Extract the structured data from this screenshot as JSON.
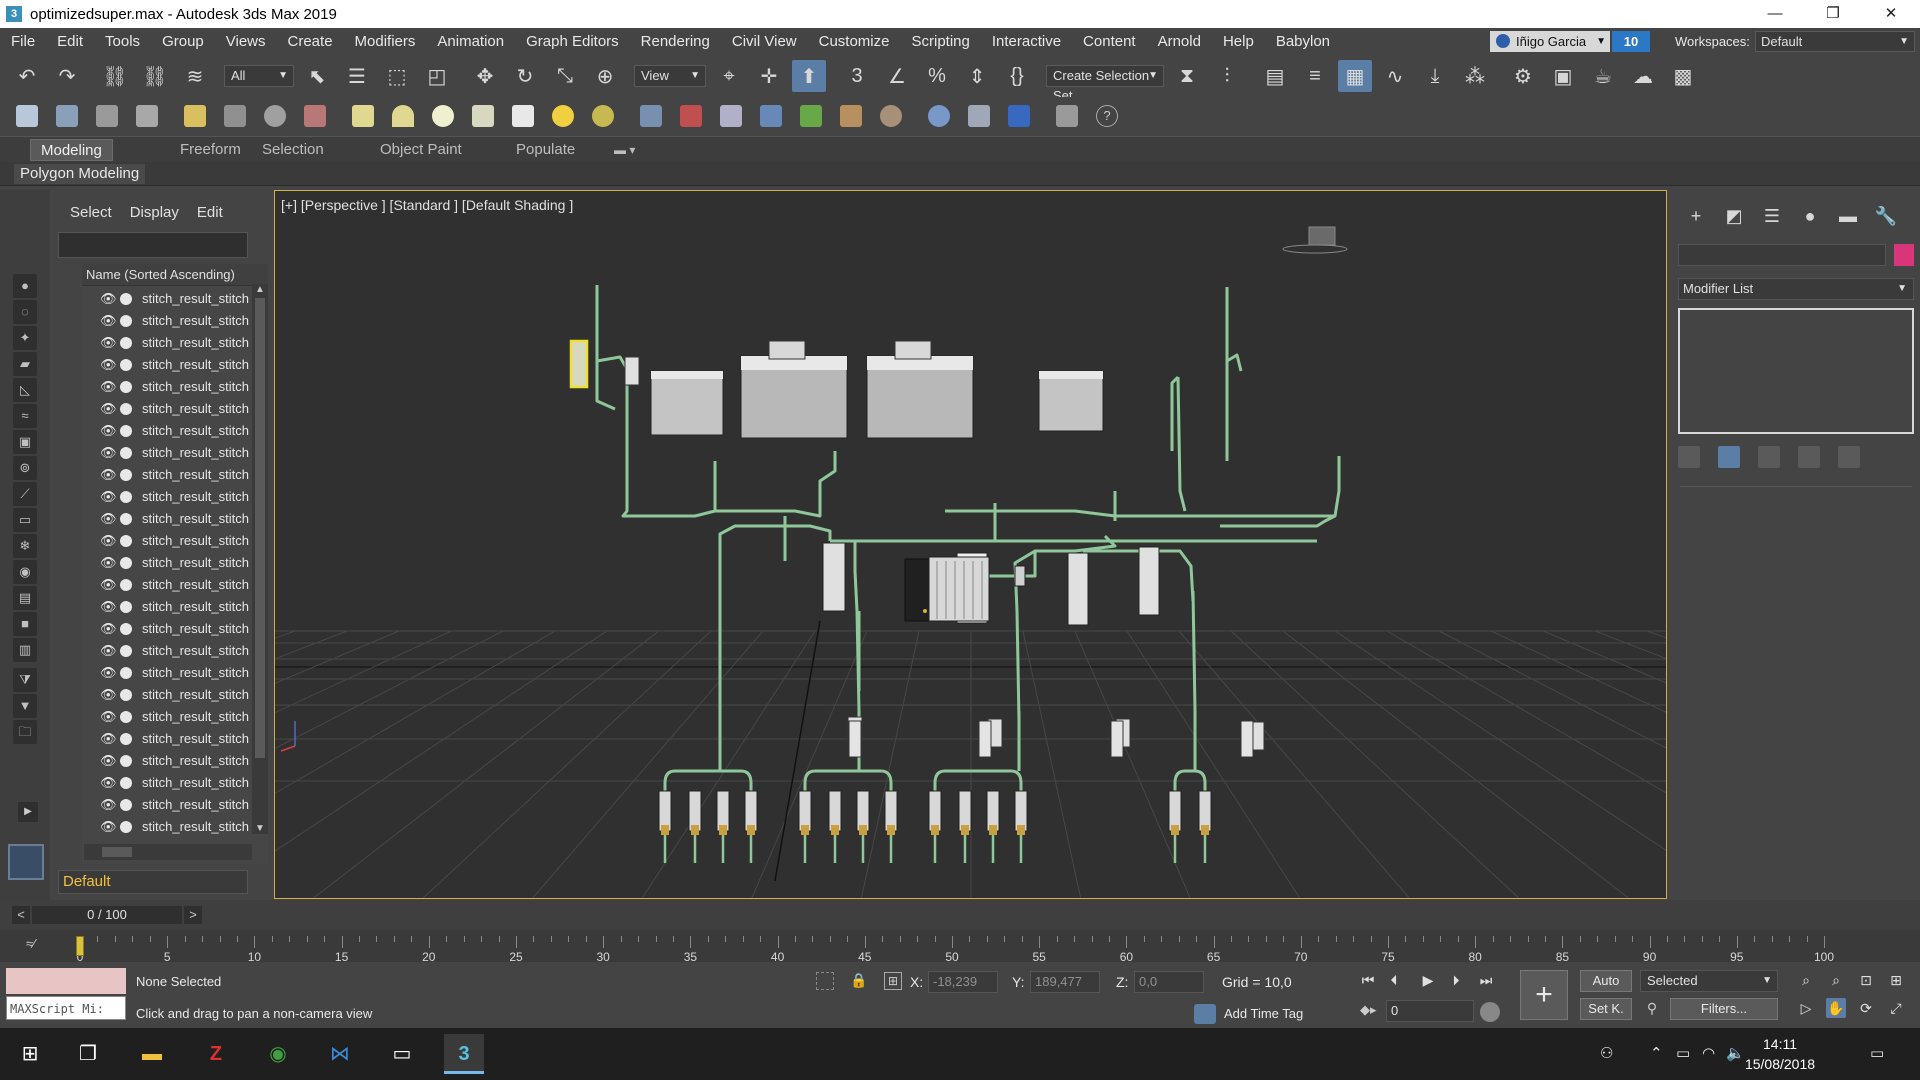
{
  "window": {
    "title": "optimizedsuper.max - Autodesk 3ds Max 2019",
    "app_icon": "3",
    "controls": [
      "—",
      "❐",
      "✕"
    ]
  },
  "menu": {
    "items": [
      "File",
      "Edit",
      "Tools",
      "Group",
      "Views",
      "Create",
      "Modifiers",
      "Animation",
      "Graph Editors",
      "Rendering",
      "Civil View",
      "Customize",
      "Scripting",
      "Interactive",
      "Content",
      "Arnold",
      "Help",
      "Babylon"
    ],
    "user": "Iñigo Garcia",
    "notifications": "10",
    "workspaces_label": "Workspaces:",
    "workspace": "Default"
  },
  "toolbar": {
    "selection_filter": "All",
    "ref_coord": "View",
    "named_selection": "Create Selection Set"
  },
  "ribbon": {
    "tabs": [
      "Modeling",
      "Freeform",
      "Selection",
      "Object Paint",
      "Populate"
    ],
    "active_tab": "Modeling",
    "panel": "Polygon Modeling"
  },
  "explorer": {
    "tabs": [
      "Select",
      "Display",
      "Edit"
    ],
    "column_header": "Name (Sorted Ascending)",
    "row_name": "stitch_result_stitch",
    "row_count": 25,
    "layer": "Default"
  },
  "viewport": {
    "label": "[+] [Perspective ] [Standard ] [Default Shading ]",
    "colors": {
      "background": "#303030",
      "grid": "#474747",
      "cable": "#8fc79a",
      "box": "#c4c4c4",
      "selected": "#f0e030"
    }
  },
  "command_panel": {
    "tabs": [
      "+",
      "◩",
      "☰",
      "●",
      "▬",
      "🔧"
    ],
    "modifier_list": "Modifier List",
    "object_color": "#d8357a"
  },
  "timeline": {
    "frame_display": "0 / 100",
    "prev": "<",
    "next": ">",
    "ticks": [
      0,
      5,
      10,
      15,
      20,
      25,
      30,
      35,
      40,
      45,
      50,
      55,
      60,
      65,
      70,
      75,
      80,
      85,
      90,
      95,
      100
    ],
    "current_frame": 0
  },
  "status": {
    "maxscript": "MAXScript Mi:",
    "selection": "None Selected",
    "prompt": "Click and drag to pan a non-camera view",
    "x_label": "X:",
    "x_value": "-18,239",
    "y_label": "Y:",
    "y_value": "189,477",
    "z_label": "Z:",
    "z_value": "0,0",
    "grid": "Grid = 10,0",
    "add_time_tag": "Add Time Tag",
    "auto": "Auto",
    "setk": "Set K.",
    "selected": "Selected",
    "filters": "Filters...",
    "frame": "0"
  },
  "taskbar": {
    "time": "14:11",
    "date": "15/08/2018"
  }
}
